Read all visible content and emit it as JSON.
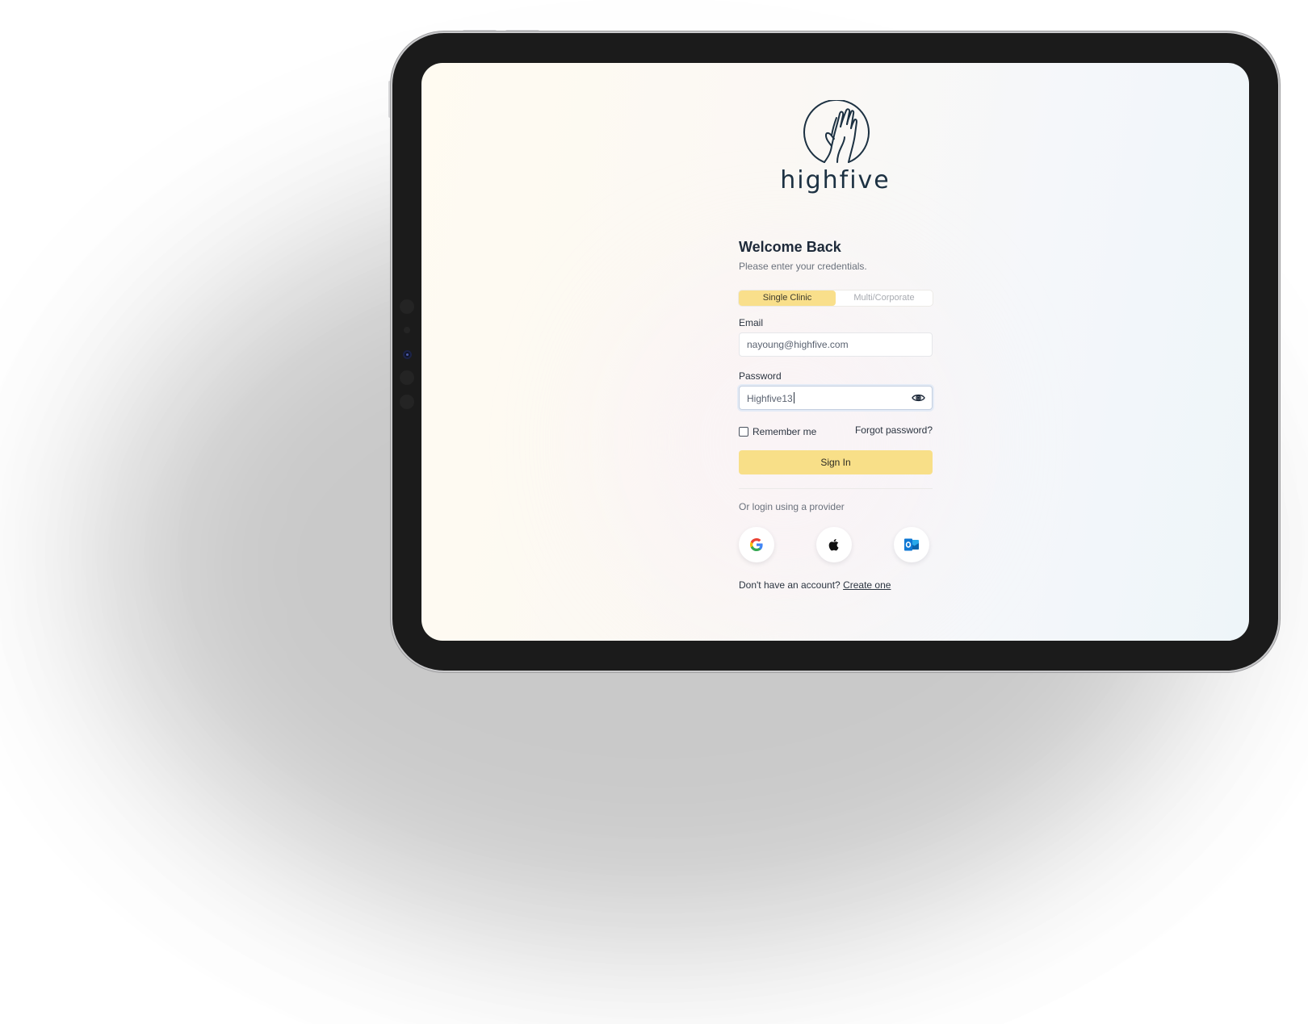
{
  "app": {
    "brand_name": "highfive"
  },
  "login": {
    "title": "Welcome Back",
    "subtitle": "Please enter your credentials.",
    "account_types": [
      {
        "label": "Single Clinic",
        "selected": true
      },
      {
        "label": "Multi/Corporate",
        "selected": false
      }
    ],
    "email": {
      "label": "Email",
      "value": "nayoung@highfive.com"
    },
    "password": {
      "label": "Password",
      "value": "Highfive13",
      "toggle_icon": "eye-icon"
    },
    "remember_me": {
      "label": "Remember me",
      "checked": false
    },
    "forgot_password_label": "Forgot password?",
    "sign_in_label": "Sign In",
    "provider_prompt": "Or login using a provider",
    "providers": [
      {
        "name": "google",
        "icon": "google-icon"
      },
      {
        "name": "apple",
        "icon": "apple-icon"
      },
      {
        "name": "outlook",
        "icon": "outlook-icon"
      }
    ],
    "signup_prompt": "Don't have an account?",
    "signup_link": "Create one"
  },
  "colors": {
    "accent": "#f8df88",
    "text_primary": "#1e2a3a",
    "text_muted": "#6a717c",
    "brand_navy": "#1c3142",
    "device_bezel": "#1b1b1b"
  }
}
